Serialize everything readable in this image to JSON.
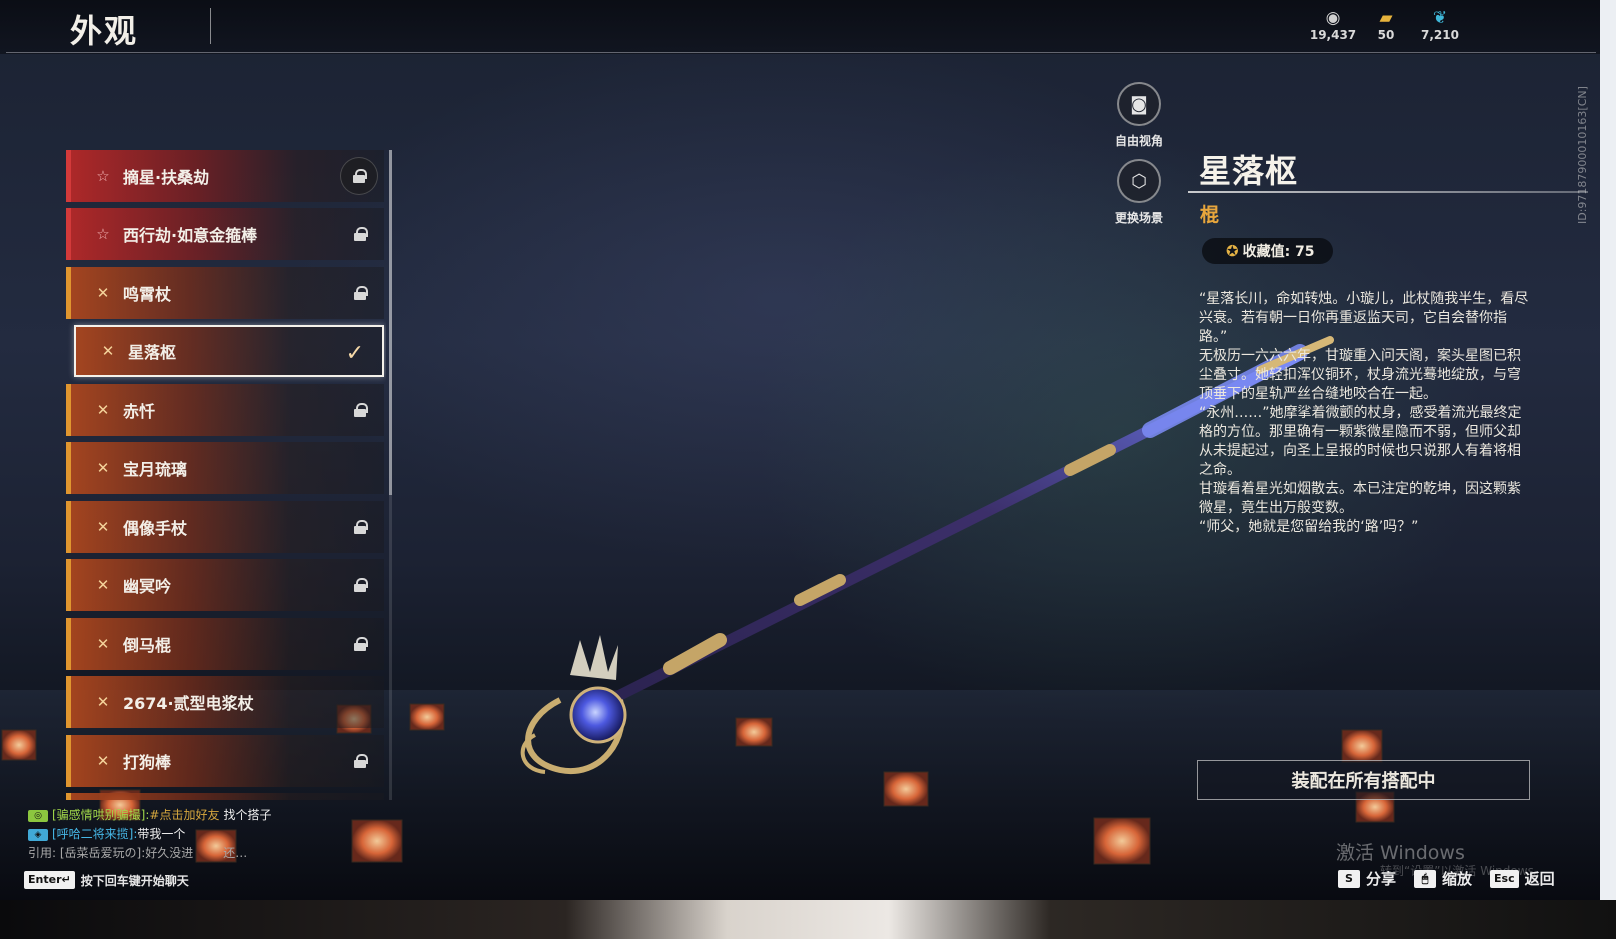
{
  "header": {
    "title": "外观",
    "currencies": [
      {
        "icon": "coin-stack-icon",
        "glyph": "◉",
        "value": "19,437",
        "color": "#d0d0d0"
      },
      {
        "icon": "ticket-icon",
        "glyph": "▰",
        "value": "50",
        "color": "#e6b33c"
      },
      {
        "icon": "feather-icon",
        "glyph": "❦",
        "value": "7,210",
        "color": "#3fb7d8"
      }
    ]
  },
  "weapon_list": [
    {
      "name": "摘星·扶桑劫",
      "rarity": "red",
      "state": "locked-ring"
    },
    {
      "name": "西行劫·如意金箍棒",
      "rarity": "red",
      "state": "locked"
    },
    {
      "name": "鸣霄杖",
      "rarity": "gold",
      "state": "locked"
    },
    {
      "name": "星落枢",
      "rarity": "gold",
      "state": "equipped"
    },
    {
      "name": "赤忏",
      "rarity": "gold",
      "state": "locked"
    },
    {
      "name": "宝月琉璃",
      "rarity": "gold",
      "state": "owned"
    },
    {
      "name": "偶像手杖",
      "rarity": "gold",
      "state": "locked"
    },
    {
      "name": "幽冥吟",
      "rarity": "gold",
      "state": "locked"
    },
    {
      "name": "倒马棍",
      "rarity": "gold",
      "state": "locked"
    },
    {
      "name": "2674·贰型电浆杖",
      "rarity": "gold",
      "state": "owned"
    },
    {
      "name": "打狗棒",
      "rarity": "gold",
      "state": "locked"
    }
  ],
  "camera": {
    "free_view": "自由视角",
    "change_scene": "更换场景"
  },
  "detail": {
    "name": "星落枢",
    "type": "棍",
    "collection_label": "收藏值: 75",
    "lore": [
      "“星落长川，命如转烛。小璇儿，此杖随我半生，看尽兴衰。若有朝一日你再重返监天司，它自会替你指路。”",
      "无极历一六六六年，甘璇重入问天阁，案头星图已积尘叠寸。她轻扣浑仪铜环，杖身流光蓦地绽放，与穹顶垂下的星轨严丝合缝地咬合在一起。",
      "“永州……”她摩挲着微颤的杖身，感受着流光最终定格的方位。那里确有一颗紫微星隐而不弱，但师父却从未提起过，向圣上呈报的时候也只说那人有着将相之命。",
      "甘璇看着星光如烟散去。本已注定的乾坤，因这颗紫微星，竟生出万般变数。",
      "“师父，她就是您留给我的‘路’吗？”"
    ],
    "equip_button": "装配在所有搭配中"
  },
  "chat": {
    "lines": [
      {
        "channel_icon": "team-channel-icon",
        "channel_color": "#8cc63f",
        "sender": "[骗感情哄别骗撮]:",
        "link": "#点击加好友",
        "text": "找个搭子"
      },
      {
        "channel_icon": "world-channel-icon",
        "channel_color": "#41a9d6",
        "sender": "[呼哈二将来揽]:",
        "link": "",
        "text": "带我一个"
      },
      {
        "channel_icon": "",
        "channel_color": "",
        "sender": "引用: [岳菜岳爱玩の]:好久没进",
        "link": "",
        "text": "还…"
      }
    ],
    "enter_key": "Enter↵",
    "enter_hint": "按下回车键开始聊天"
  },
  "hotkeys": [
    {
      "key": "S",
      "label": "分享"
    },
    {
      "key": "🖱",
      "label": "缩放"
    },
    {
      "key": "Esc",
      "label": "返回"
    }
  ],
  "watermark": {
    "line1": "激活 Windows",
    "line2": "转到“设置”以激活 Windows。"
  },
  "build_id": "ID:97187900010163[CN]"
}
